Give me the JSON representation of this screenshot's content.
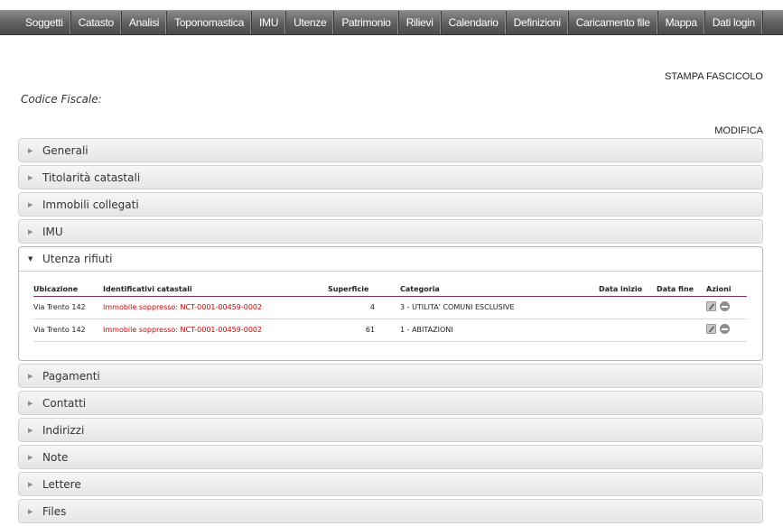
{
  "nav": {
    "items": [
      "Soggetti",
      "Catasto",
      "Analisi",
      "Toponomastica",
      "IMU",
      "Utenze",
      "Patrimonio",
      "Rilievi",
      "Calendario",
      "Definizioni",
      "Caricamento file",
      "Mappa",
      "Dati login"
    ]
  },
  "page": {
    "stampa_label": "STAMPA FASCICOLO",
    "codice_fiscale_label": "Codice Fiscale:",
    "modifica_label": "MODIFICA"
  },
  "sections": {
    "generali": "Generali",
    "titolarita": "Titolarità catastali",
    "immobili": "Immobili collegati",
    "imu": "IMU",
    "utenza": "Utenza rifiuti",
    "pagamenti": "Pagamenti",
    "contatti": "Contatti",
    "indirizzi": "Indirizzi",
    "note": "Note",
    "lettere": "Lettere",
    "files": "Files"
  },
  "utenza_table": {
    "headers": {
      "ubicazione": "Ubicazione",
      "identificativi": "Identificativi catastali",
      "superficie": "Superficie",
      "categoria": "Categoria",
      "data_inizio": "Data inizio",
      "data_fine": "Data fine",
      "azioni": "Azioni"
    },
    "rows": [
      {
        "ubicazione": "Via Trento 142",
        "identificativi": "Immobile soppresso: NCT-0001-00459-0002",
        "superficie": "4",
        "categoria": "3 - UTILITA' COMUNI ESCLUSIVE",
        "data_inizio": "",
        "data_fine": ""
      },
      {
        "ubicazione": "Via Trento 142",
        "identificativi": "Immobile soppresso: NCT-0001-00459-0002",
        "superficie": "61",
        "categoria": "1 - ABITAZIONI",
        "data_inizio": "",
        "data_fine": ""
      }
    ]
  },
  "icons": {
    "collapsed": "triangle-right-icon",
    "expanded": "triangle-down-icon",
    "edit": "edit-icon",
    "remove": "remove-icon"
  },
  "colors": {
    "nav_bg": "#5e5e5e",
    "link_red": "#cc0000",
    "header_rule": "#7a2e5a"
  }
}
